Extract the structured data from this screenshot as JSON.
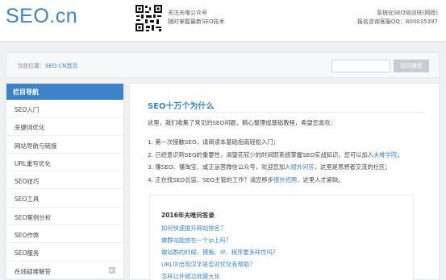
{
  "header": {
    "logo": "SEO.cn",
    "qr_line1": "关注夫唯公众号",
    "qr_line2": "随时掌握最新SEO技术",
    "right_line1": "系统化SEO培训班(网授)",
    "right_line2": "报名咨询客服QQ：800035397"
  },
  "breadcrumb": {
    "prefix": "当前位置：",
    "link": "SEO.CN首页"
  },
  "search": {
    "placeholder": "",
    "button_label": "站内搜索"
  },
  "sidebar": {
    "title": "栏目导航",
    "items": [
      {
        "label": "SEO入门"
      },
      {
        "label": "关键词优化"
      },
      {
        "label": "网站导航与链接"
      },
      {
        "label": "URL重写优化"
      },
      {
        "label": "SEO技巧"
      },
      {
        "label": "SEO工具"
      },
      {
        "label": "SEO案例分析"
      },
      {
        "label": "SEO作弊"
      },
      {
        "label": "SEO服务"
      },
      {
        "label": "在线疑难解答"
      }
    ]
  },
  "main": {
    "title": "SEO十万个为什么",
    "intro": "这里，我们收集了常见的SEO问题，精心整理成基础教程，希望您喜欢：",
    "points": [
      {
        "text": "1. 第一次接触SEO，请阅读本基础指南轻松入门；",
        "link": "",
        "after": ""
      },
      {
        "text": "2. 已经意识到SEO的重要性，渴望花较少的时间即系统掌握SEO实战知识，您可以加入",
        "link": "夫唯学院",
        "after": "；"
      },
      {
        "text": "3. 懂SEO、懂淘宝、或正运营微信公众号，欢迎您加入",
        "link": "搜外问答",
        "after": "，这里是思想者交流的社区；"
      },
      {
        "text": "4. 正在找SEO总监、SEO主管的工作？请您移步",
        "link": "搜外招聘",
        "after": "，这里人才紧缺。"
      }
    ],
    "qa": {
      "title": "2016年夫唯问答录",
      "items": [
        "如何快速提升网站排名？",
        "做群站能放在一个ip上吗？",
        "做站群的时候，模板、IP、程序要多样性吗？",
        "URL中出现汉字是否对优化有帮助？",
        "怎样让外链功效最大化"
      ]
    }
  }
}
